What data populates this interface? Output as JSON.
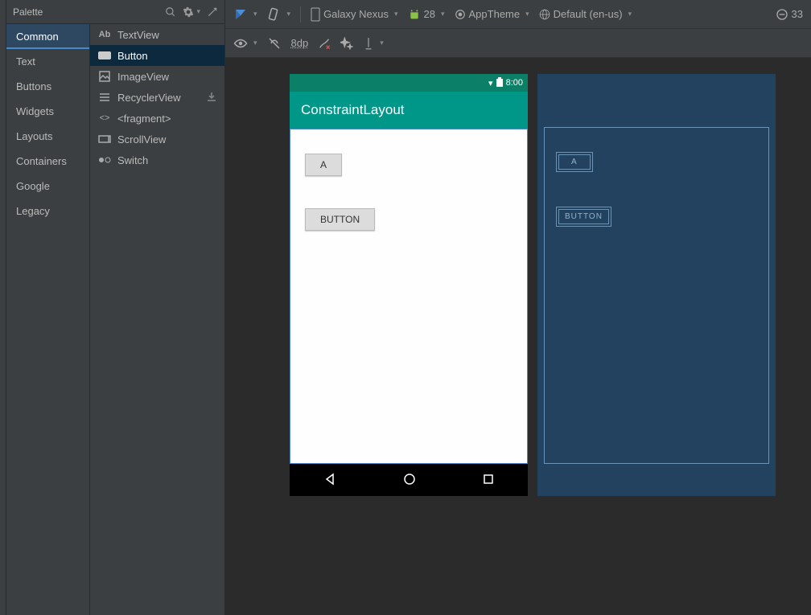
{
  "palette": {
    "title": "Palette",
    "categories": [
      "Common",
      "Text",
      "Buttons",
      "Widgets",
      "Layouts",
      "Containers",
      "Google",
      "Legacy"
    ],
    "selected_category": "Common",
    "items": [
      {
        "icon": "Ab",
        "label": "TextView"
      },
      {
        "icon": "□",
        "label": "Button",
        "selected": true
      },
      {
        "icon": "▣",
        "label": "ImageView"
      },
      {
        "icon": "≡",
        "label": "RecyclerView",
        "download": true
      },
      {
        "icon": "<>",
        "label": "<fragment>"
      },
      {
        "icon": "▭",
        "label": "ScrollView"
      },
      {
        "icon": "•◦",
        "label": "Switch"
      }
    ]
  },
  "toolbar": {
    "device": "Galaxy Nexus",
    "api": "28",
    "theme": "AppTheme",
    "locale": "Default (en-us)",
    "zoom": "33",
    "margin": "8dp"
  },
  "preview": {
    "time": "8:00",
    "title": "ConstraintLayout",
    "buttons": [
      "A",
      "BUTTON"
    ]
  },
  "blueprint": {
    "buttons": [
      "A",
      "BUTTON"
    ]
  }
}
